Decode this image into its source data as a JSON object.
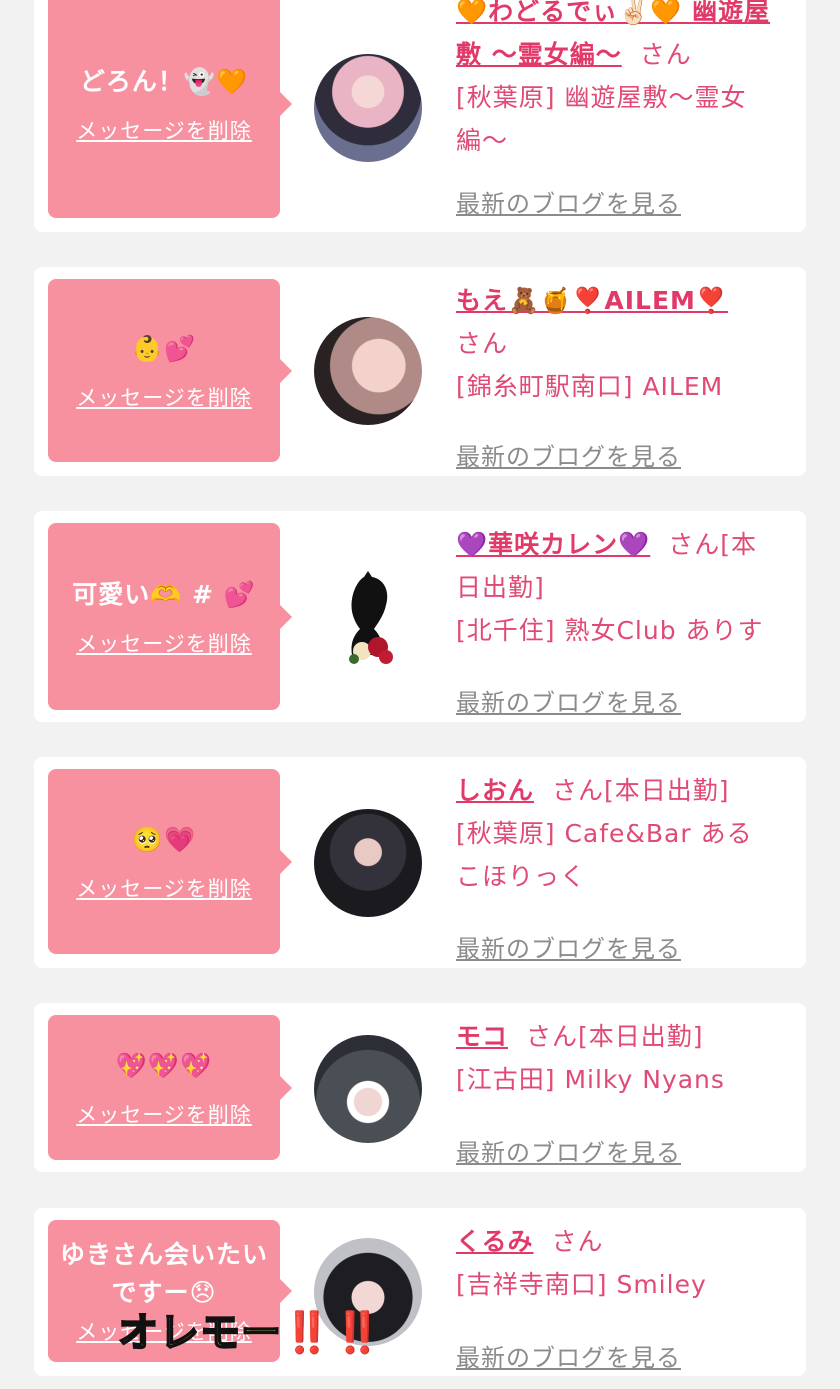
{
  "delete_label": "メッセージを削除",
  "blog_label": "最新のブログを見る",
  "san_label": "さん",
  "cards": [
    {
      "message": "どろん！👻🧡",
      "name": "🧡わどるでぃ✌🏻🧡 幽遊屋敷 〜霊女編〜",
      "suffix": "さん",
      "shop_line1": "[秋葉原] 幽遊屋敷〜霊女",
      "shop_line2": "編〜"
    },
    {
      "message": "👶💕",
      "name": "もえ🧸🍯❣️AILEM❣️",
      "suffix": "さん",
      "shop_line1": "[錦糸町駅南口] AILEM"
    },
    {
      "message": "可愛い🫶 # 💕",
      "name": "💜華咲カレン💜",
      "suffix": "さん[本",
      "suffix2": "日出勤]",
      "shop_line1": "[北千住] 熟女Club ありす"
    },
    {
      "message": "🥺💗",
      "name": "しおん",
      "suffix": "さん[本日出勤]",
      "shop_line1": "[秋葉原] Cafe&Bar ある",
      "shop_line2": "こほりっく"
    },
    {
      "message": "💖💖💖",
      "name": "モコ",
      "suffix": "さん[本日出勤]",
      "shop_line1": "[江古田] Milky Nyans"
    },
    {
      "message_line1": "ゆきさん会いたい",
      "message_line2": "ですー😞",
      "name": "くるみ",
      "suffix": "さん",
      "shop_line1": "[吉祥寺南口] Smiley"
    }
  ],
  "overlay_text": "オレモー",
  "overlay_bang": "‼️‼️",
  "colors": {
    "bubble": "#f7919f",
    "name": "#e13a69",
    "text": "#e14a74",
    "link_gray": "#8b8b8b",
    "page_bg": "#f2f2f2"
  }
}
